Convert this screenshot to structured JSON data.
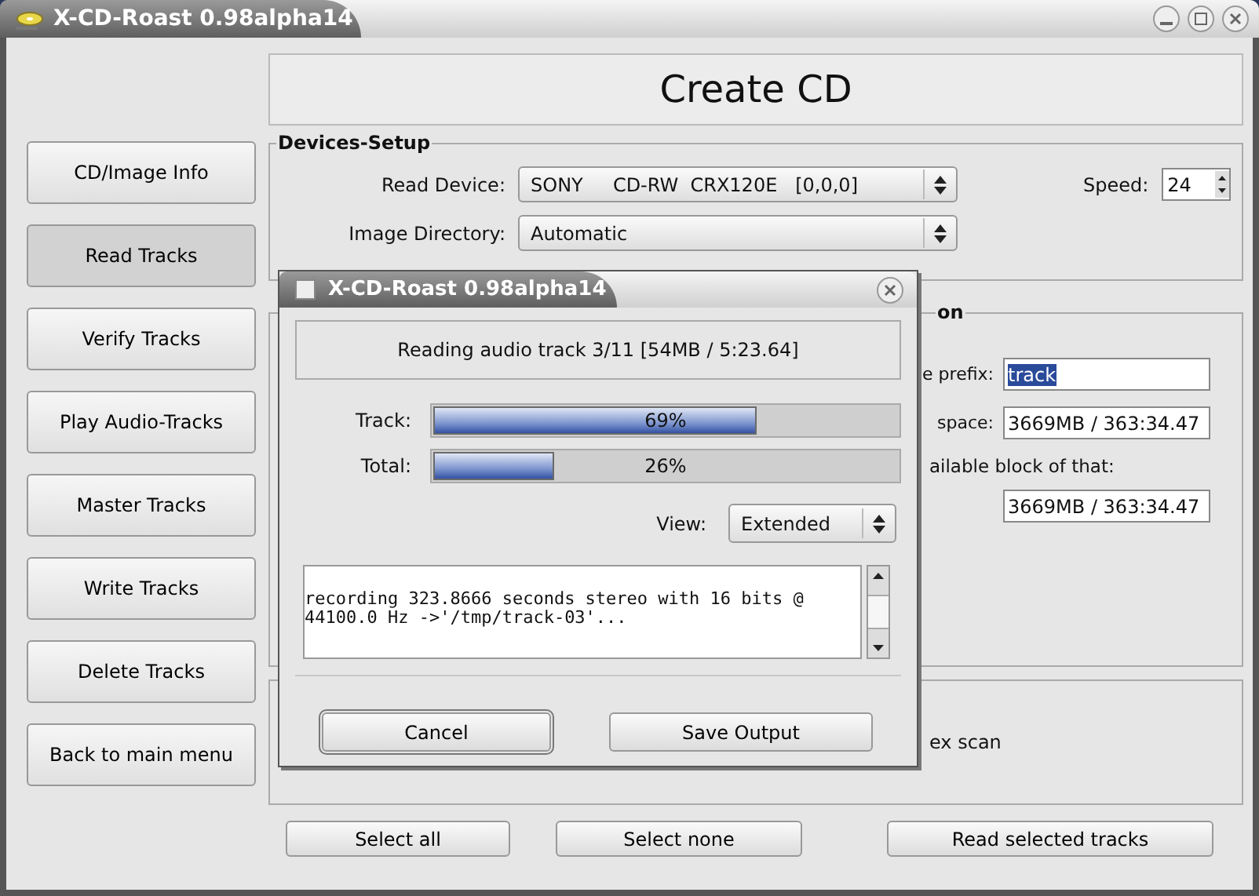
{
  "window": {
    "title": "X-CD-Roast 0.98alpha14"
  },
  "sidebar": {
    "items": [
      {
        "label": "CD/Image Info",
        "selected": false
      },
      {
        "label": "Read Tracks",
        "selected": true
      },
      {
        "label": "Verify Tracks",
        "selected": false
      },
      {
        "label": "Play Audio-Tracks",
        "selected": false
      },
      {
        "label": "Master Tracks",
        "selected": false
      },
      {
        "label": "Write Tracks",
        "selected": false
      },
      {
        "label": "Delete Tracks",
        "selected": false
      },
      {
        "label": "Back to main menu",
        "selected": false
      }
    ]
  },
  "header": {
    "title": "Create CD"
  },
  "devices_setup": {
    "title": "Devices-Setup",
    "read_device_label": "Read Device:",
    "read_device": "SONY     CD-RW  CRX120E   [0,0,0]",
    "speed_label": "Speed:",
    "speed": "24",
    "image_directory_label": "Image Directory:",
    "image_directory": "Automatic"
  },
  "section_2": {
    "title": "on",
    "rows": [
      {
        "label": "e prefix:",
        "value": "track",
        "selected": true
      },
      {
        "label": "space:",
        "value": "3669MB / 363:34.47",
        "selected": false
      }
    ],
    "note": "ailable block of that:",
    "note_value": "3669MB / 363:34.47"
  },
  "section_3": {
    "text": "ex scan"
  },
  "buttons": [
    "Select all",
    "Select none",
    "Read selected tracks"
  ],
  "dialog": {
    "title": "X-CD-Roast 0.98alpha14",
    "status": "Reading audio track 3/11 [54MB / 5:23.64]",
    "progress": [
      {
        "label": "Track:",
        "level": 0.69,
        "reading": "69%"
      },
      {
        "label": "Total:",
        "level": 0.26,
        "reading": "26%"
      }
    ],
    "view_label": "View:",
    "view": "Extended",
    "log_lines": [
      "recording 323.8666 seconds stereo with 16 bits @",
      "44100.0 Hz ->'/tmp/track-03'..."
    ],
    "buttons": [
      {
        "label": "Cancel",
        "default": true
      },
      {
        "label": "Save Output",
        "default": false
      }
    ]
  }
}
